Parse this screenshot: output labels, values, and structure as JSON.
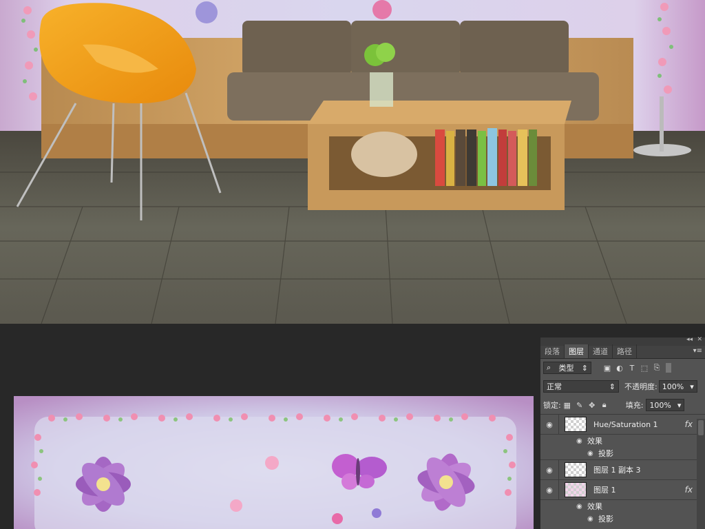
{
  "scene": {
    "description_colors": {
      "wall": "#d7c6e3",
      "floor": "#5c5a4e",
      "sofa": "#6f6253",
      "chair": "#f2a21a",
      "wood": "#c99a5a"
    }
  },
  "panel": {
    "collapse_glyph": "◂◂",
    "close_glyph": "✕",
    "tabs": [
      "段落",
      "图层",
      "通道",
      "路径"
    ],
    "active_tab_index": 1,
    "menu_glyph": "▾≡",
    "filter": {
      "label": "类型",
      "icon": "search-icon"
    },
    "blend_mode": "正常",
    "opacity_label": "不透明度:",
    "opacity_value": "100%",
    "lock_label": "锁定:",
    "fill_label": "填充:",
    "fill_value": "100%",
    "fx_label": "fx",
    "layers": [
      {
        "name": "Hue/Saturation 1",
        "fx": true,
        "effects_label": "效果",
        "effect": "投影"
      },
      {
        "name": "图层 1 副本 3",
        "fx": false
      },
      {
        "name": "图层 1",
        "fx": true,
        "effects_label": "效果",
        "effect": "投影"
      }
    ]
  }
}
